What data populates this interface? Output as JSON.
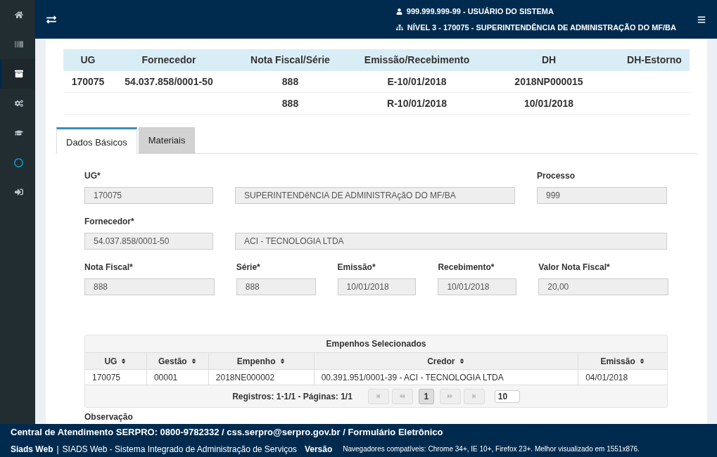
{
  "sidebar": {
    "items": [
      {
        "selected": false
      },
      {
        "selected": false
      },
      {
        "selected": true
      },
      {
        "selected": false
      },
      {
        "selected": false
      },
      {
        "selected": false
      },
      {
        "selected": false
      }
    ]
  },
  "header": {
    "user": "999.999.999-99 - USUÁRIO DO SISTEMA",
    "level": "NÍVEL 3 - 170075 - SUPERINTENDÊNCIA DE ADMINISTRAÇÃO DO MF/BA"
  },
  "summary_table": {
    "columns": [
      "UG",
      "Fornecedor",
      "Nota Fiscal/Série",
      "Emissão/Recebimento",
      "DH",
      "DH-Estorno"
    ],
    "rows": [
      [
        "170075",
        "54.037.858/0001-50",
        "888",
        "E-10/01/2018",
        "2018NP000015",
        ""
      ],
      [
        "",
        "",
        "888",
        "R-10/01/2018",
        "10/01/2018",
        ""
      ]
    ]
  },
  "tabs": [
    {
      "label": "Dados Básicos",
      "selected": true
    },
    {
      "label": "Materiais",
      "selected": false
    }
  ],
  "form": {
    "ug": {
      "label": "UG*",
      "value": "170075"
    },
    "ug_name": {
      "value": "SUPERINTENDêNCIA DE ADMINISTRAçãO DO MF/BA"
    },
    "processo": {
      "label": "Processo",
      "value": "999"
    },
    "fornecedor": {
      "label": "Fornecedor*",
      "value": "54.037.858/0001-50"
    },
    "fornecedor_name": {
      "value": "ACI - TECNOLOGIA LTDA"
    },
    "nota_fiscal": {
      "label": "Nota Fiscal*",
      "value": "888"
    },
    "serie": {
      "label": "Série*",
      "value": "888"
    },
    "emissao": {
      "label": "Emissão*",
      "value": "10/01/2018"
    },
    "recebimento": {
      "label": "Recebimento*",
      "value": "10/01/2018"
    },
    "valor": {
      "label": "Valor Nota Fiscal*",
      "value": "20,00"
    }
  },
  "empenhos": {
    "title": "Empenhos Selecionados",
    "columns": [
      "UG",
      "Gestão",
      "Empenho",
      "Credor",
      "Emissão"
    ],
    "rows": [
      [
        "170075",
        "00001",
        "2018NE000002",
        "00.391.951/0001-39 - ACI - TECNOLOGIA LTDA",
        "04/01/2018"
      ]
    ],
    "pager": {
      "info": "Registros: 1-1/1 - Páginas: 1/1",
      "pages": [
        {
          "label": "1",
          "selected": true
        }
      ],
      "page_size": "10"
    }
  },
  "observacao_label": "Observação",
  "footer": {
    "line1": "Central de Atendimento SERPRO: 0800-9782332 / css.serpro@serpro.gov.br / Formulário Eletrônico",
    "app": "Siads Web",
    "separator": "|",
    "system": "SIADS Web - Sistema Integrado de Administração de Serviços",
    "version": "Versão",
    "browsers": "Navegadores compatíveis: Chrome 34+, IE 10+, Firefox 23+. Melhor visualizado em 1551x876."
  }
}
